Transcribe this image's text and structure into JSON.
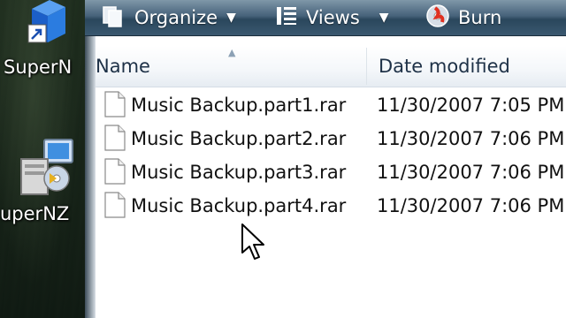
{
  "desktop": {
    "icons": [
      {
        "label": "SuperN",
        "icon": "blue-cube-shortcut-icon"
      },
      {
        "label": "uperNZ",
        "icon": "installer-monitor-icon"
      }
    ]
  },
  "toolbar": {
    "organize_label": "Organize",
    "views_label": "Views",
    "burn_label": "Burn",
    "dropdown_glyph": "▼"
  },
  "columns": {
    "name": "Name",
    "date_modified": "Date modified",
    "sort_indicator": "▲"
  },
  "files": [
    {
      "name": "Music Backup.part1.rar",
      "date_modified": "11/30/2007 7:05 PM",
      "icon": "document-file-icon"
    },
    {
      "name": "Music Backup.part2.rar",
      "date_modified": "11/30/2007 7:06 PM",
      "icon": "document-file-icon"
    },
    {
      "name": "Music Backup.part3.rar",
      "date_modified": "11/30/2007 7:06 PM",
      "icon": "document-file-icon"
    },
    {
      "name": "Music Backup.part4.rar",
      "date_modified": "11/30/2007 7:06 PM",
      "icon": "document-file-icon"
    }
  ],
  "colors": {
    "toolbar": "#46627a",
    "header_text": "#1e3147",
    "window_bg": "#ffffff"
  }
}
